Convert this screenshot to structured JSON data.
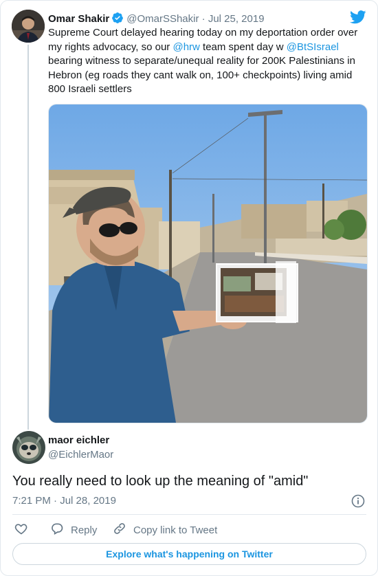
{
  "parent": {
    "name": "Omar Shakir",
    "handle": "@OmarSShakir",
    "separator": "·",
    "date": "Jul 25, 2019",
    "text": {
      "t1": "Supreme Court delayed hearing today on my deportation order over my rights advocacy, so our ",
      "m1": "@hrw",
      "t2": " team spent day w ",
      "m2": "@BtSIsrael",
      "t3": " bearing witness to separate/unequal reality for 200K Palestinians in Hebron (eg roads they cant walk on, 100+ checkpoints) living amid 800 Israeli settlers"
    }
  },
  "reply": {
    "name": "maor eichler",
    "handle": "@EichlerMaor",
    "text": "You really need to look up the meaning of \"amid\"",
    "time": "7:21 PM",
    "separator": "·",
    "date": "Jul 28, 2019"
  },
  "actions": {
    "reply_label": "Reply",
    "copy_link_label": "Copy link to Tweet"
  },
  "explore_label": "Explore what's happening on Twitter",
  "colors": {
    "accent": "#1b95e0",
    "twitter_blue": "#1da1f2",
    "muted": "#657786",
    "border": "#e1e8ed"
  },
  "icons": [
    "verified-badge-icon",
    "twitter-bird-icon",
    "info-icon",
    "heart-icon",
    "reply-bubble-icon",
    "link-icon"
  ]
}
